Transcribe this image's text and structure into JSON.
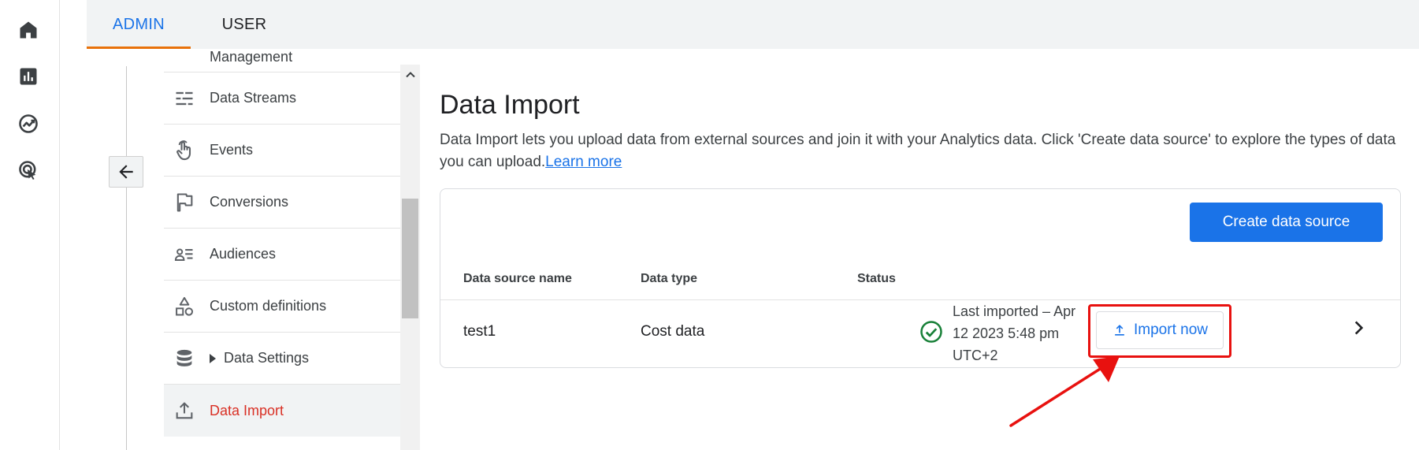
{
  "tabs": [
    {
      "label": "ADMIN",
      "active": true
    },
    {
      "label": "USER",
      "active": false
    }
  ],
  "rail": {
    "icons": [
      "home-icon",
      "reports-icon",
      "explore-icon",
      "advertising-icon"
    ]
  },
  "nav": {
    "partial_label": "Management",
    "items": [
      {
        "label": "Data Streams",
        "icon": "data-streams-icon"
      },
      {
        "label": "Events",
        "icon": "touch-icon"
      },
      {
        "label": "Conversions",
        "icon": "flag-icon"
      },
      {
        "label": "Audiences",
        "icon": "audiences-icon"
      },
      {
        "label": "Custom definitions",
        "icon": "shapes-icon"
      },
      {
        "label": "Data Settings",
        "icon": "database-icon"
      },
      {
        "label": "Data Import",
        "icon": "upload-icon"
      }
    ]
  },
  "main": {
    "title": "Data Import",
    "description": "Data Import lets you upload data from external sources and join it with your Analytics data. Click 'Create data source' to explore the types of data you can upload.",
    "learn_more": "Learn more",
    "create_button": "Create data source",
    "table": {
      "headers": [
        "Data source name",
        "Data type",
        "Status"
      ],
      "row": {
        "name": "test1",
        "type": "Cost data",
        "status": "Last imported – Apr 12 2023 5:48 pm UTC+2",
        "action": "Import now"
      }
    }
  },
  "colors": {
    "accent": "#1a73e8",
    "active_tab_underline": "#e8710a",
    "active_nav": "#d93025",
    "annotation": "#e8110f",
    "status_ok": "#188038"
  }
}
